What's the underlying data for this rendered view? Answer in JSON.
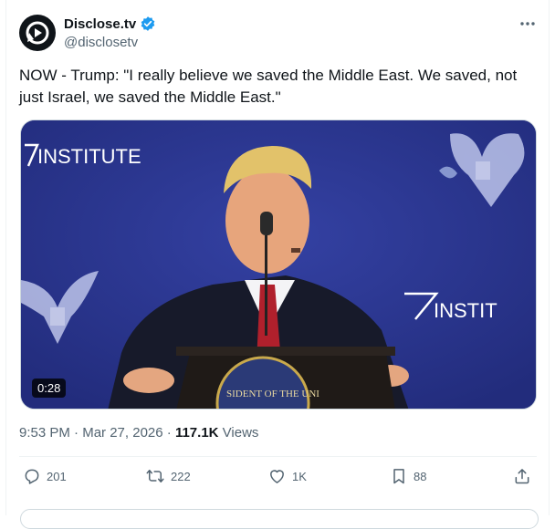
{
  "account": {
    "name": "Disclose.tv",
    "handle": "@disclosetv"
  },
  "tweet": {
    "text": "NOW - Trump: \"I really believe we saved the Middle East. We saved, not just Israel, we saved the Middle East.\"",
    "time": "9:53 PM",
    "date": "Mar 27, 2026",
    "separator": "·",
    "views_count": "117.1K",
    "views_label": "Views"
  },
  "media": {
    "duration": "0:28",
    "sign_left": "INSTITUTE",
    "sign_right": "INSTIT",
    "seal_text": "SIDENT OF THE UNI"
  },
  "actions": {
    "replies": "201",
    "reposts": "222",
    "likes": "1K",
    "bookmarks": "88"
  },
  "colors": {
    "verified": "#1d9bf0",
    "secondary_text": "#536471",
    "stage_blue": "#2c3791"
  }
}
